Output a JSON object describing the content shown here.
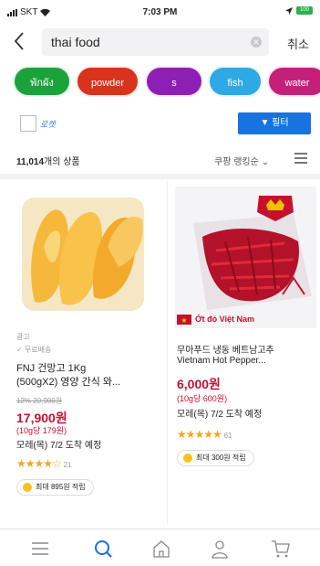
{
  "status_bar": {
    "carrier": "SKT",
    "time": "7:03 PM",
    "battery": "100"
  },
  "search": {
    "value": "thai food",
    "cancel_label": "취소",
    "clear_icon": "clear-icon",
    "back_icon": "back-chevron-icon"
  },
  "chips": [
    {
      "label": "พักผัง",
      "color": "#1aa33a"
    },
    {
      "label": "powder",
      "color": "#d9331d"
    },
    {
      "label": "s",
      "color": "#8e1fb5"
    },
    {
      "label": "fish",
      "color": "#2fa8e6"
    },
    {
      "label": "water",
      "color": "#c4207a"
    }
  ],
  "filters": {
    "rocket_label": "로켓",
    "filter_label": "필터"
  },
  "results": {
    "count": "11,014",
    "count_suffix": "개의 상품",
    "sort_label": "쿠팡 랭킹순"
  },
  "products": [
    {
      "ad": "광고",
      "free_shipping": "무료배송",
      "name_line1": "FNJ 건망고 1Kg",
      "name_line2": "(500gX2) 영양 간식 와...",
      "discount_line": "12% 20,900원",
      "price": "17,900원",
      "unit_price": "(10g당 179원)",
      "delivery": "모레(목) 7/2 도착 예정",
      "rating": 4,
      "reviews": "21",
      "reward": "최대 895원 적립"
    },
    {
      "name_line1": "무아푸드 냉동 베트남고추",
      "name_line2": "Vietnam Hot Pepper...",
      "price": "6,000원",
      "unit_price": "(10g당 600원)",
      "delivery": "모레(목) 7/2 도착 예정",
      "rating": 5,
      "reviews": "61",
      "reward": "최대 300원 적립",
      "image_caption": "Ớt đỏ Việt Nam"
    }
  ],
  "tabbar": [
    "menu-icon",
    "search-icon",
    "home-icon",
    "user-icon",
    "cart-icon"
  ],
  "colors": {
    "accent": "#1872e0",
    "price_red": "#c8102e",
    "star": "#f5a623"
  }
}
